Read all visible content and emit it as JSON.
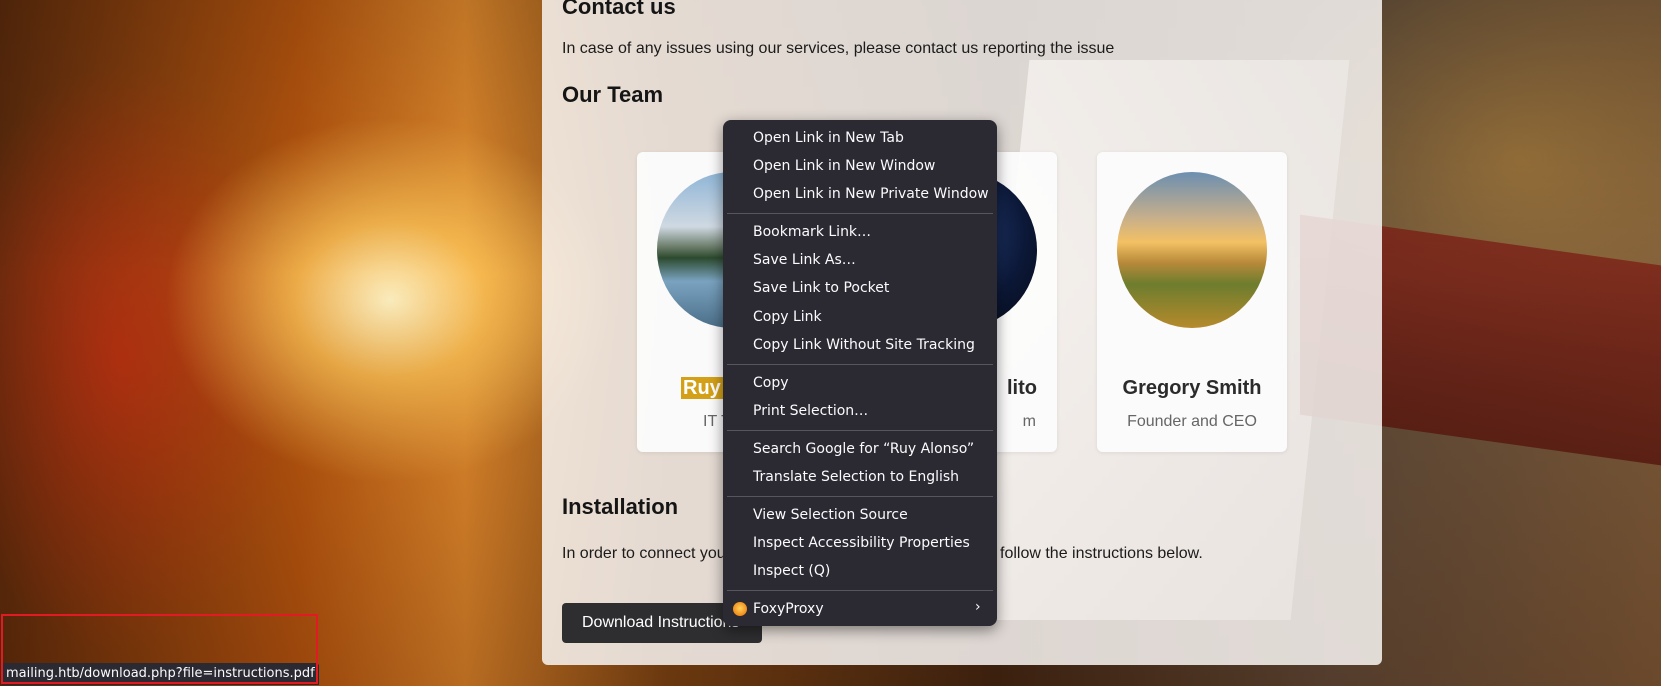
{
  "page": {
    "contact_heading": "Contact us",
    "contact_text": "In case of any issues using our services, please contact us reporting the issue",
    "team_heading": "Our Team",
    "team": [
      {
        "name_visible": "Ruy A",
        "name_full": "Ruy Alonso",
        "role_visible": "IT T"
      },
      {
        "name_visible": "lito",
        "role_visible": "m"
      },
      {
        "name": "Gregory Smith",
        "role": "Founder and CEO"
      }
    ],
    "installation_heading": "Installation",
    "installation_text_left": "In order to connect you",
    "installation_text_right": "follow the instructions below.",
    "download_button": "Download Instructions"
  },
  "context_menu": {
    "items": [
      "Open Link in New Tab",
      "Open Link in New Window",
      "Open Link in New Private Window",
      "Bookmark Link…",
      "Save Link As…",
      "Save Link to Pocket",
      "Copy Link",
      "Copy Link Without Site Tracking",
      "Copy",
      "Print Selection…",
      "Search Google for “Ruy Alonso”",
      "Translate Selection to English",
      "View Selection Source",
      "Inspect Accessibility Properties",
      "Inspect (Q)",
      "FoxyProxy"
    ],
    "foxyproxy_icon": "foxyproxy-icon",
    "submenu_icon": "chevron-right-icon"
  },
  "status_bar": {
    "url": "mailing.htb/download.php?file=instructions.pdf"
  },
  "colors": {
    "menu_bg": "#2b2a33",
    "highlight": "#d4a017",
    "focus_outline": "#e01b24"
  }
}
